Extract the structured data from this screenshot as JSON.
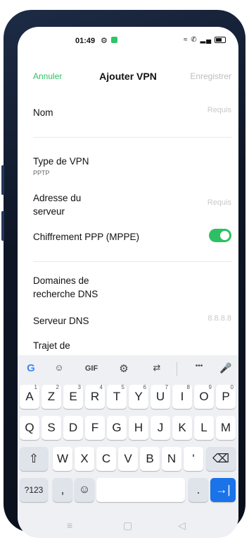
{
  "status_bar": {
    "time": "01:49"
  },
  "header": {
    "cancel": "Annuler",
    "title": "Ajouter VPN",
    "save": "Enregistrer"
  },
  "form": {
    "name_label": "Nom",
    "name_placeholder": "Requis",
    "vpn_type_label": "Type de VPN",
    "vpn_type_value": "PPTP",
    "server_label_line1": "Adresse du",
    "server_label_line2": "serveur",
    "server_placeholder": "Requis",
    "mppe_label": "Chiffrement PPP (MPPE)",
    "mppe_enabled": true,
    "dns_search_line1": "Domaines de",
    "dns_search_line2": "recherche DNS",
    "dns_server_label": "Serveur DNS",
    "dns_server_placeholder": "8.8.8.8",
    "route_label": "Trajet de"
  },
  "keyboard": {
    "toolbar": {
      "google": "G",
      "gif": "GIF",
      "more": "•••"
    },
    "row1": [
      {
        "k": "A",
        "h": "1"
      },
      {
        "k": "Z",
        "h": "2"
      },
      {
        "k": "E",
        "h": "3"
      },
      {
        "k": "R",
        "h": "4"
      },
      {
        "k": "T",
        "h": "5"
      },
      {
        "k": "Y",
        "h": "6"
      },
      {
        "k": "U",
        "h": "7"
      },
      {
        "k": "I",
        "h": "8"
      },
      {
        "k": "O",
        "h": "9"
      },
      {
        "k": "P",
        "h": "0"
      }
    ],
    "row2": [
      "Q",
      "S",
      "D",
      "F",
      "G",
      "H",
      "J",
      "K",
      "L",
      "M"
    ],
    "row3": [
      "W",
      "X",
      "C",
      "V",
      "B",
      "N",
      "'"
    ],
    "row4": {
      "symbols": "?123",
      "comma": ",",
      "period": "."
    }
  },
  "colors": {
    "accent": "#2fbf63",
    "enter_key": "#1a73e8"
  }
}
